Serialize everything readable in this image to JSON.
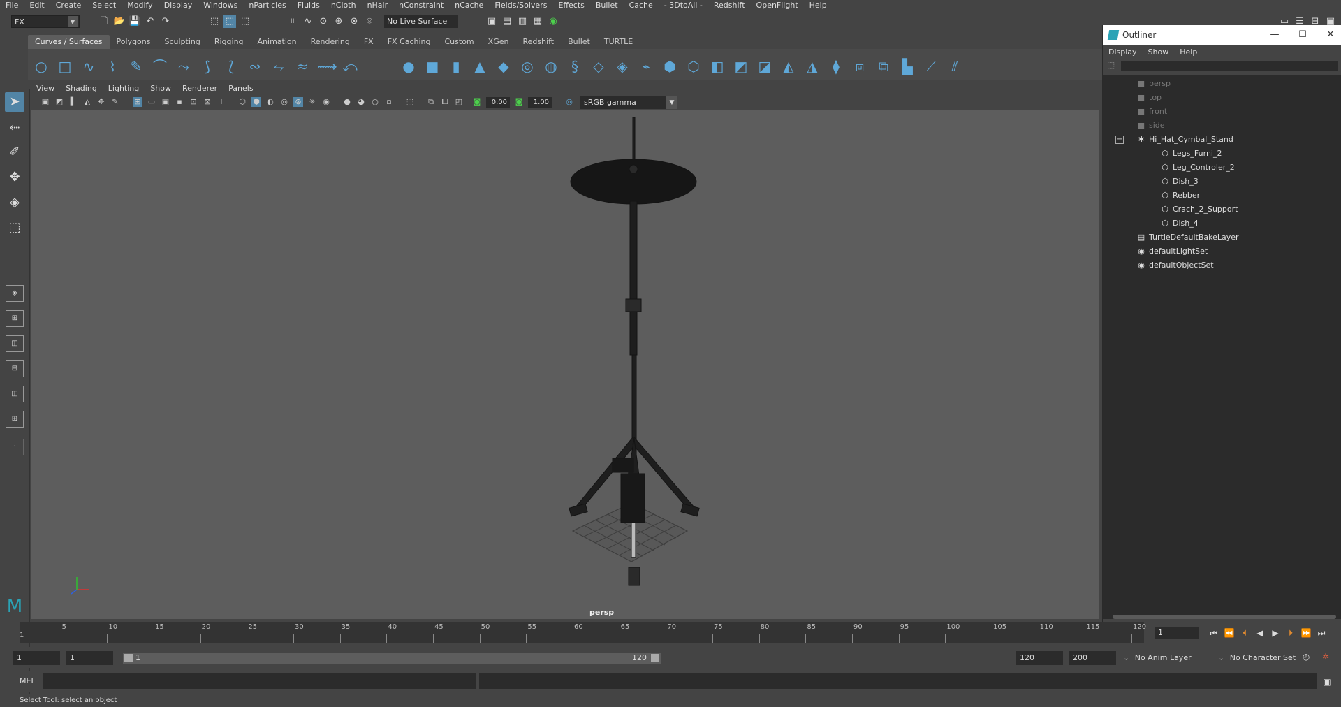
{
  "menubar": [
    "File",
    "Edit",
    "Create",
    "Select",
    "Modify",
    "Display",
    "Windows",
    "nParticles",
    "Fluids",
    "nCloth",
    "nHair",
    "nConstraint",
    "nCache",
    "Fields/Solvers",
    "Effects",
    "Bullet",
    "Cache",
    "- 3DtoAll -",
    "Redshift",
    "OpenFlight",
    "Help"
  ],
  "status": {
    "mode": "FX",
    "live_surface": "No Live Surface"
  },
  "shelf_tabs": [
    "Curves / Surfaces",
    "Polygons",
    "Sculpting",
    "Rigging",
    "Animation",
    "Rendering",
    "FX",
    "FX Caching",
    "Custom",
    "XGen",
    "Redshift",
    "Bullet",
    "TURTLE"
  ],
  "active_shelf_tab": "Curves / Surfaces",
  "panel_menu": [
    "View",
    "Shading",
    "Lighting",
    "Show",
    "Renderer",
    "Panels"
  ],
  "panel_bar": {
    "exposure": "0.00",
    "gamma": "1.00",
    "color_space": "sRGB gamma"
  },
  "viewport": {
    "camera_label": "persp"
  },
  "outliner": {
    "title": "Outliner",
    "menu": [
      "Display",
      "Show",
      "Help"
    ],
    "items": [
      {
        "label": "persp",
        "dim": true,
        "icon": "camera-icon",
        "level": 0
      },
      {
        "label": "top",
        "dim": true,
        "icon": "camera-icon",
        "level": 0
      },
      {
        "label": "front",
        "dim": true,
        "icon": "camera-icon",
        "level": 0
      },
      {
        "label": "side",
        "dim": true,
        "icon": "camera-icon",
        "level": 0
      },
      {
        "label": "Hi_Hat_Cymbal_Stand",
        "dim": false,
        "icon": "group-icon",
        "level": 0,
        "expanded": true
      },
      {
        "label": "Legs_Furni_2",
        "dim": false,
        "icon": "mesh-icon",
        "level": 1
      },
      {
        "label": "Leg_Controler_2",
        "dim": false,
        "icon": "mesh-icon",
        "level": 1
      },
      {
        "label": "Dish_3",
        "dim": false,
        "icon": "mesh-icon",
        "level": 1
      },
      {
        "label": "Rebber",
        "dim": false,
        "icon": "mesh-icon",
        "level": 1
      },
      {
        "label": "Crach_2_Support",
        "dim": false,
        "icon": "mesh-icon",
        "level": 1
      },
      {
        "label": "Dish_4",
        "dim": false,
        "icon": "mesh-icon",
        "level": 1
      },
      {
        "label": "TurtleDefaultBakeLayer",
        "dim": false,
        "icon": "layer-icon",
        "level": 0
      },
      {
        "label": "defaultLightSet",
        "dim": false,
        "icon": "set-icon",
        "level": 0
      },
      {
        "label": "defaultObjectSet",
        "dim": false,
        "icon": "set-icon",
        "level": 0
      }
    ]
  },
  "timeline": {
    "ticks": [
      "5",
      "10",
      "15",
      "20",
      "25",
      "30",
      "35",
      "40",
      "45",
      "50",
      "55",
      "60",
      "65",
      "70",
      "75",
      "80",
      "85",
      "90",
      "95",
      "100",
      "105",
      "110",
      "115",
      "120"
    ],
    "current_frame_marker": "1",
    "current_frame": "1"
  },
  "range": {
    "start_time": "1",
    "playback_start": "1",
    "range_start_label": "1",
    "range_end_label": "120",
    "playback_end": "120",
    "end_time": "200",
    "anim_layer": "No Anim Layer",
    "character_set": "No Character Set"
  },
  "command_line": {
    "label": "MEL"
  },
  "help_line": "Select Tool: select an object"
}
